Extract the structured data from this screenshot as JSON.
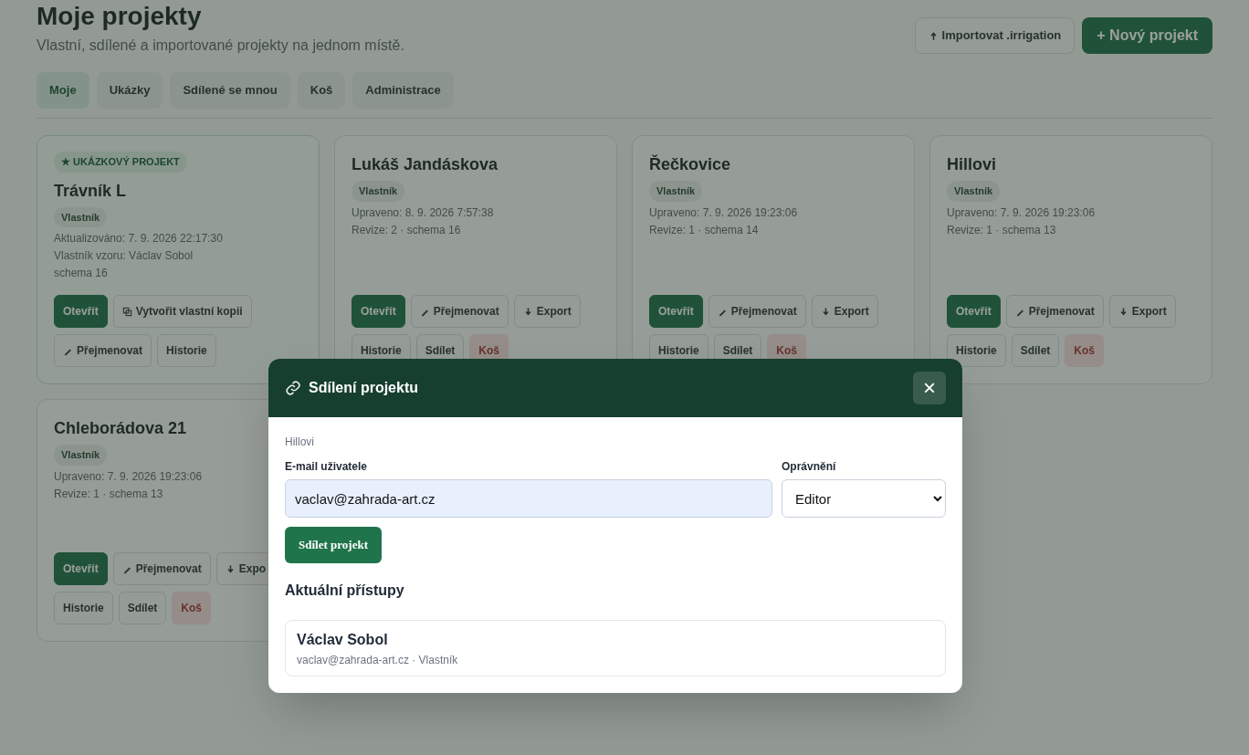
{
  "header": {
    "title": "Moje projekty",
    "subtitle": "Vlastní, sdílené a importované projekty na jednom místě.",
    "buttons": [
      {
        "label": "Importovat .irrigation",
        "kind": "import"
      },
      {
        "label": "+ Nový projekt",
        "kind": "primary"
      }
    ]
  },
  "tabs": [
    {
      "label": "Moje",
      "selected": true
    },
    {
      "label": "Ukázky",
      "selected": false
    },
    {
      "label": "Sdílené se mnou",
      "selected": false
    },
    {
      "label": "Koš",
      "selected": false
    },
    {
      "label": "Administrace",
      "selected": false
    }
  ],
  "cards": [
    {
      "badge": "★ UKÁZKOVÝ PROJEKT",
      "title": "Trávník L",
      "role": "Vlastník",
      "meta": [
        "Aktualizováno: 7. 9. 2026 22:17:30",
        "Vlastník vzoru: Václav Sobol",
        "schema 16"
      ],
      "actions": [
        {
          "label": "Otevřít",
          "kind": "primary"
        },
        {
          "label": "Vytvořit vlastní kopii",
          "kind": "copy"
        },
        {
          "label": "Přejmenovat",
          "kind": "rename"
        },
        {
          "label": "Historie",
          "kind": "default"
        }
      ]
    },
    {
      "title": "Lukáš Jandáskova",
      "role": "Vlastník",
      "meta": [
        "Upraveno: 8. 9. 2026 7:57:38",
        "Revize: 2 · schema 16"
      ],
      "actions": [
        {
          "label": "Otevřít",
          "kind": "primary"
        },
        {
          "label": "Přejmenovat",
          "kind": "rename"
        },
        {
          "label": "Export",
          "kind": "export"
        },
        {
          "label": "Historie",
          "kind": "default"
        },
        {
          "label": "Sdílet",
          "kind": "default"
        },
        {
          "label": "Koš",
          "kind": "danger"
        }
      ]
    },
    {
      "title": "Řečkovice",
      "role": "Vlastník",
      "meta": [
        "Upraveno: 7. 9. 2026 19:23:06",
        "Revize: 1 · schema 14"
      ],
      "actions": [
        {
          "label": "Otevřít",
          "kind": "primary"
        },
        {
          "label": "Přejmenovat",
          "kind": "rename"
        },
        {
          "label": "Export",
          "kind": "export"
        },
        {
          "label": "Historie",
          "kind": "default"
        },
        {
          "label": "Sdílet",
          "kind": "default"
        },
        {
          "label": "Koš",
          "kind": "danger"
        }
      ]
    },
    {
      "title": "Hillovi",
      "role": "Vlastník",
      "meta": [
        "Upraveno: 7. 9. 2026 19:23:06",
        "Revize: 1 · schema 13"
      ],
      "actions": [
        {
          "label": "Otevřít",
          "kind": "primary"
        },
        {
          "label": "Přejmenovat",
          "kind": "rename"
        },
        {
          "label": "Export",
          "kind": "export"
        },
        {
          "label": "Historie",
          "kind": "default"
        },
        {
          "label": "Sdílet",
          "kind": "default"
        },
        {
          "label": "Koš",
          "kind": "danger"
        }
      ]
    },
    {
      "title": "Chleborádova 21",
      "role": "Vlastník",
      "meta": [
        "Upraveno: 7. 9. 2026 19:23:06",
        "Revize: 1 · schema 13"
      ],
      "actions": [
        {
          "label": "Otevřít",
          "kind": "primary"
        },
        {
          "label": "Přejmenovat",
          "kind": "rename"
        },
        {
          "label": "Expo",
          "kind": "export"
        },
        {
          "label": "Historie",
          "kind": "default"
        },
        {
          "label": "Sdílet",
          "kind": "default"
        },
        {
          "label": "Koš",
          "kind": "danger"
        }
      ]
    }
  ],
  "modal": {
    "title": "Sdílení projektu",
    "close": "×",
    "project": "Hillovi",
    "email_label": "E-mail uživatele",
    "email_value": "vaclav@zahrada-art.cz",
    "permission_label": "Oprávnění",
    "permission_value": "Editor",
    "submit": "Sdílet projekt",
    "access_title": "Aktuální přístupy",
    "access": [
      {
        "name": "Václav Sobol",
        "detail": "vaclav@zahrada-art.cz · Vlastník"
      }
    ]
  }
}
